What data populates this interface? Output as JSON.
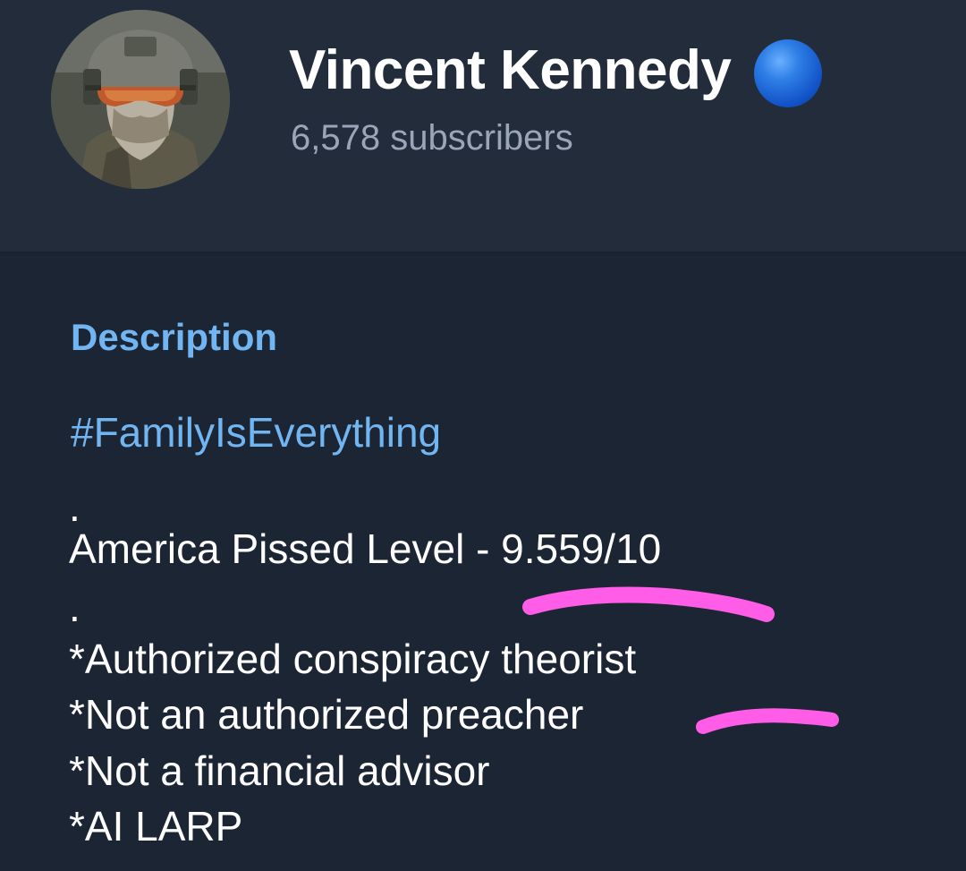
{
  "channel": {
    "name": "Vincent Kennedy",
    "subscribers": "6,578 subscribers",
    "verified_badge_color": "#1a5fd6"
  },
  "description": {
    "section_title": "Description",
    "hashtag": "#FamilyIsEverything",
    "lines": [
      ".",
      "America Pissed Level - 9.559/10",
      ".",
      "*Authorized conspiracy theorist",
      "*Not an authorized preacher",
      "*Not a financial advisor",
      "*AI LARP"
    ]
  },
  "colors": {
    "background": "#1c2533",
    "header_background": "#222c3b",
    "accent_link": "#71b5f2",
    "highlight_marker": "#ff5ce8"
  },
  "icons": [
    "avatar",
    "verified-icon"
  ]
}
